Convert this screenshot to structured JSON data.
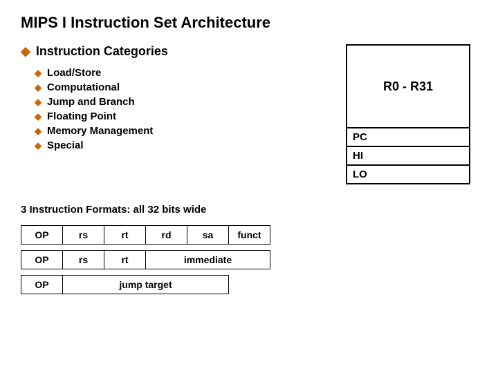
{
  "page": {
    "title": "MIPS I Instruction Set Architecture",
    "instruction_categories": {
      "heading": "Instruction Categories",
      "items": [
        "Load/Store",
        "Computational",
        "Jump and Branch",
        "Floating Point",
        "Memory Management",
        "Special"
      ]
    },
    "register_diagram": {
      "r0_r31_label": "R0 - R31",
      "pc_label": "PC",
      "hi_label": "HI",
      "lo_label": "LO"
    },
    "formats_section": {
      "title": "3 Instruction Formats: all 32 bits wide",
      "format1": {
        "cells": [
          "OP",
          "rs",
          "rt",
          "rd",
          "sa",
          "funct"
        ]
      },
      "format2": {
        "cells": [
          "OP",
          "rs",
          "rt",
          "immediate"
        ]
      },
      "format3": {
        "cells": [
          "OP",
          "jump target"
        ]
      }
    }
  }
}
